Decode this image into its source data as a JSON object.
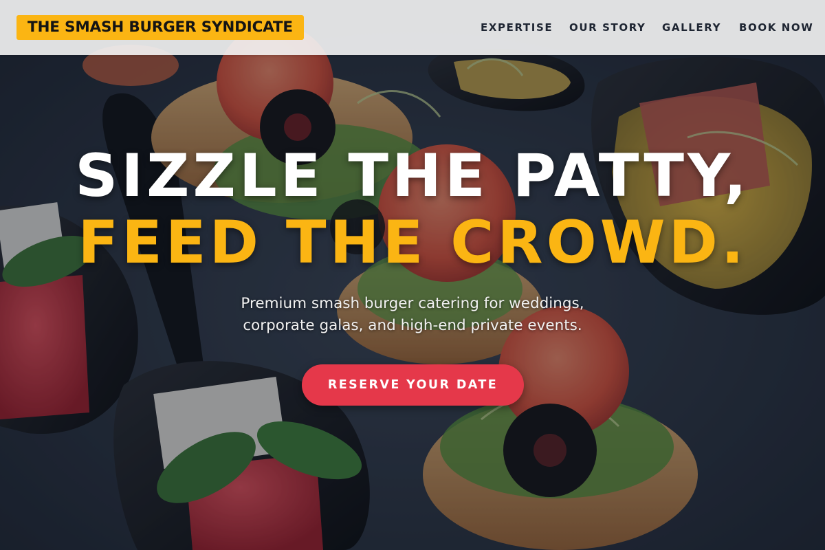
{
  "header": {
    "brand": "THE SMASH BURGER SYNDICATE",
    "nav": [
      {
        "label": "EXPERTISE"
      },
      {
        "label": "OUR STORY"
      },
      {
        "label": "GALLERY"
      },
      {
        "label": "BOOK NOW"
      }
    ]
  },
  "hero": {
    "headline_line1": "SIZZLE THE PATTY,",
    "headline_line2": "FEED THE CROWD.",
    "subtext_line1": "Premium smash burger catering for weddings,",
    "subtext_line2": "corporate galas, and high-end private events.",
    "cta_label": "RESERVE YOUR DATE",
    "background_image": "catering appetizers on slate"
  },
  "colors": {
    "accent_yellow": "#fbb513",
    "cta_red": "#e5384a",
    "nav_text": "#1e2532",
    "slate": "#27313f"
  }
}
